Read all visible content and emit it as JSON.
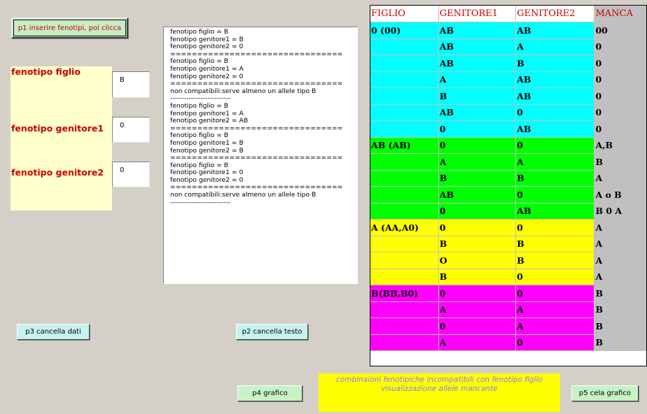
{
  "buttons": {
    "p1": "p1 inserire fenotipi, poi clicca",
    "p3": "p3 cancella dati",
    "p2": "p2 cancella testo",
    "p4": "p4 grafico",
    "p5": "p5 cela grafico"
  },
  "fields": {
    "figlio_label": "fenotipo figlio",
    "figlio_value": "B",
    "gen1_label": "fenotipo genitore1",
    "gen1_value": "0",
    "gen2_label": "fenotipo genitore2",
    "gen2_value": "0"
  },
  "log_text": "fenotipo figlio = B\nfenotipo genitore1 = B\nfenotipo genitore2 = 0\n================================\nfenotipo figlio = B\nfenotipo genitore1 = A\nfenotipo genitore2 = 0\n================================\nnon compatibili:serve almeno un allele tipo B\n--------------------------\nfenotipo figlio = B\nfenotipo genitore1 = A\nfenotipo genitore2 = AB\n================================\nfenotipo figlio = B\nfenotipo genitore1 = B\nfenotipo genitore2 = B\n================================\nfenotipo figlio = B\nfenotipo genitore1 = 0\nfenotipo genitore2 = 0\n================================\nnon compatibili:serve almeno un allele tipo B\n--------------------------",
  "table": {
    "headers": [
      "FIGLIO",
      "GENITORE1",
      "GENITORE2",
      "MANCA"
    ],
    "colors": {
      "cyan": "#00ffff",
      "green": "#00ff00",
      "yellow": "#ffff00",
      "magenta": "#ff00ff",
      "header_text": "#cc0000",
      "manca_bg": "#c0c0c0"
    },
    "rows": [
      {
        "c": [
          "0 (00)",
          "AB",
          "AB",
          "00"
        ],
        "bg": "cyan"
      },
      {
        "c": [
          "",
          "AB",
          "A",
          "0"
        ],
        "bg": "cyan"
      },
      {
        "c": [
          "",
          "AB",
          "B",
          "0"
        ],
        "bg": "cyan"
      },
      {
        "c": [
          "",
          "A",
          "AB",
          "0"
        ],
        "bg": "cyan"
      },
      {
        "c": [
          "",
          "B",
          "AB",
          "0"
        ],
        "bg": "cyan"
      },
      {
        "c": [
          "",
          "AB",
          "0",
          "0"
        ],
        "bg": "cyan"
      },
      {
        "c": [
          "",
          "0",
          "AB",
          "0"
        ],
        "bg": "cyan"
      },
      {
        "c": [
          "AB (AB)",
          "0",
          "0",
          "A,B"
        ],
        "bg": "green"
      },
      {
        "c": [
          "",
          "A",
          "A",
          "B"
        ],
        "bg": "green"
      },
      {
        "c": [
          "",
          "B",
          "B",
          "A"
        ],
        "bg": "green"
      },
      {
        "c": [
          "",
          "AB",
          "0",
          "A o B"
        ],
        "bg": "green"
      },
      {
        "c": [
          "",
          "0",
          "AB",
          "B 0 A"
        ],
        "bg": "green"
      },
      {
        "c": [
          "A (AA,A0)",
          "0",
          "0",
          "A"
        ],
        "bg": "yellow"
      },
      {
        "c": [
          "",
          "B",
          "B",
          "A"
        ],
        "bg": "yellow"
      },
      {
        "c": [
          "",
          "O",
          "B",
          "A"
        ],
        "bg": "yellow"
      },
      {
        "c": [
          "",
          "B",
          "0",
          "A"
        ],
        "bg": "yellow"
      },
      {
        "c": [
          "B(BB,B0)",
          "0",
          "0",
          "B"
        ],
        "bg": "magenta"
      },
      {
        "c": [
          "",
          "A",
          "A",
          "B"
        ],
        "bg": "magenta"
      },
      {
        "c": [
          "",
          "0",
          "A",
          "B"
        ],
        "bg": "magenta"
      },
      {
        "c": [
          "",
          "A",
          "0",
          "B"
        ],
        "bg": "magenta"
      }
    ]
  },
  "note": {
    "line1": "combinaioni fenotipiche incompatibili con fenotipo figlio",
    "line2": "visualizzazione allele mancante"
  }
}
